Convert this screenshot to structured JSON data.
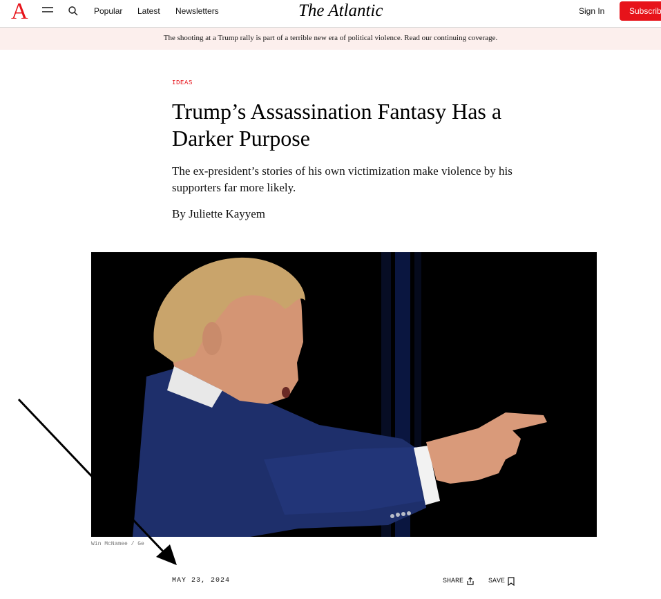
{
  "header": {
    "logo_letter": "A",
    "nav": [
      "Popular",
      "Latest",
      "Newsletters"
    ],
    "brand": "The Atlantic",
    "sign_in": "Sign In",
    "subscribe": "Subscribe"
  },
  "alert": {
    "text": "The shooting at a Trump rally is part of a terrible new era of political violence. Read our continuing coverage."
  },
  "article": {
    "section": "IDEAS",
    "headline": "Trump’s Assassination Fantasy Has a Darker Purpose",
    "dek": "The ex-president’s stories of his own victimization make violence by his supporters far more likely.",
    "byline": "By Juliette Kayyem",
    "photo_credit": "Win McNamee / Ge",
    "date": "MAY 23, 2024",
    "share_label": "SHARE",
    "save_label": "SAVE"
  },
  "icons": {
    "menu": "menu-icon",
    "search": "search-icon",
    "share": "share-icon",
    "save": "bookmark-icon"
  },
  "colors": {
    "accent": "#e7131a",
    "alert_bg": "#fcefed",
    "hero_bg": "#000000"
  }
}
